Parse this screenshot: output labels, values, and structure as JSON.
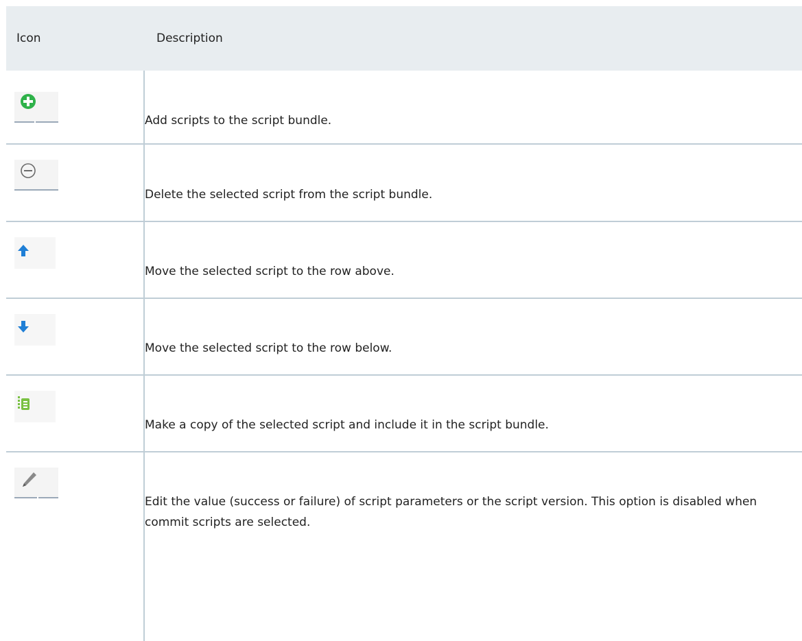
{
  "table": {
    "headers": {
      "icon": "Icon",
      "description": "Description"
    },
    "rows": [
      {
        "icon": "add-circle-icon",
        "description": "Add scripts to the script bundle."
      },
      {
        "icon": "remove-circle-icon",
        "description": "Delete the selected script from the script bundle."
      },
      {
        "icon": "arrow-up-icon",
        "description": "Move the selected script to the row above."
      },
      {
        "icon": "arrow-down-icon",
        "description": "Move the selected script to the row below."
      },
      {
        "icon": "copy-icon",
        "description": "Make a copy of the selected script and include it in the script bundle."
      },
      {
        "icon": "edit-pencil-icon",
        "description": "Edit the value (success or failure) of script parameters or the script version. This option is disabled when commit scripts are selected."
      }
    ]
  },
  "colors": {
    "header_bg": "#e8edf0",
    "divider": "#bfcdd6",
    "add_green": "#2fb24a",
    "arrow_blue": "#1f7fd6",
    "copy_green": "#79c142"
  }
}
